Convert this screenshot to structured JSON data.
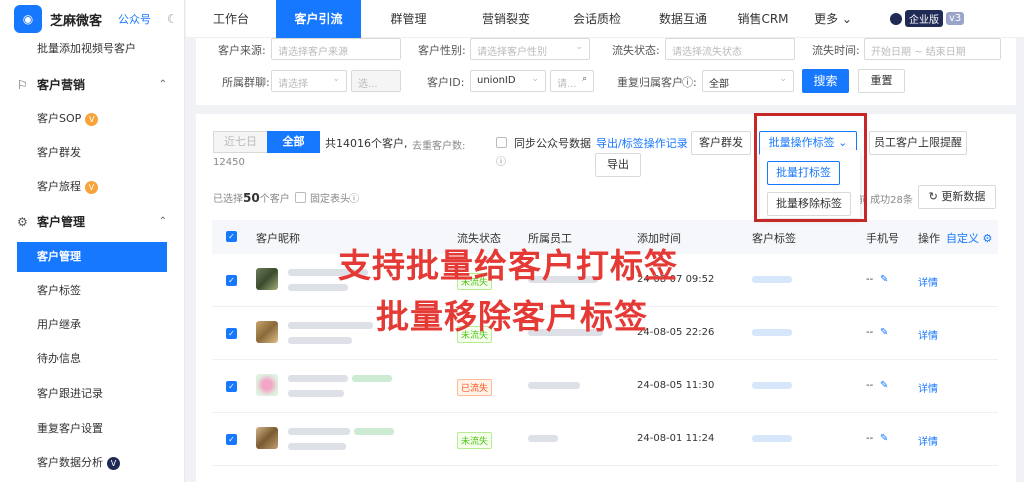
{
  "sidebar": {
    "logo_glyph": "◉",
    "app_name": "芝麻微客",
    "account_type": "公众号",
    "items": [
      {
        "label": "批量添加视频号客户"
      },
      {
        "label": "客户营销",
        "group": true
      },
      {
        "label": "客户SOP"
      },
      {
        "label": "客户群发"
      },
      {
        "label": "客户旅程"
      },
      {
        "label": "客户管理",
        "group": true
      },
      {
        "label": "客户管理",
        "active": true
      },
      {
        "label": "客户标签"
      },
      {
        "label": "用户继承"
      },
      {
        "label": "待办信息"
      },
      {
        "label": "客户跟进记录"
      },
      {
        "label": "重复客户设置"
      },
      {
        "label": "客户数据分析"
      }
    ]
  },
  "topnav": {
    "items": [
      "工作台",
      "客户引流",
      "群管理",
      "营销裂变",
      "会话质检",
      "数据互通",
      "销售CRM",
      "更多 ⌄"
    ],
    "active": "客户引流",
    "edition": {
      "label": "企业版",
      "version": "v3"
    }
  },
  "filters": {
    "source_label": "客户来源:",
    "source_placeholder": "请选择客户来源",
    "gender_label": "客户性别:",
    "gender_placeholder": "请选择客户性别",
    "churn_label": "流失状态:",
    "churn_placeholder": "请选择流失状态",
    "churn_time_label": "流失时间:",
    "start_date": "开始日期",
    "date_sep": "~",
    "end_date": "结束日期",
    "group_label": "所属群聊:",
    "group_placeholder": "请选择",
    "group_placeholder2": "选...",
    "customer_id_label": "客户ID:",
    "id_type": "unionID",
    "id_placeholder": "请...",
    "repeat_label": "重复归属客户",
    "repeat_value": "全部",
    "search_button": "搜索",
    "reset_button": "重置"
  },
  "main": {
    "seg_7days": "近七日",
    "seg_all": "全部",
    "total_text": "共14016个客户,",
    "dedupe_label": "去重客户数:",
    "dedupe_value": "12450",
    "sync_label": "同步公众号数据",
    "export_link": "导出/标签操作记录",
    "group_send_button": "客户群发",
    "batch_tag_button": "批量操作标签",
    "limit_reminder_button": "员工客户上限提醒",
    "export_button": "导出",
    "dropdown": {
      "add_tag": "批量打标签",
      "remove_tag": "批量移除标签"
    },
    "selected_prefix": "已选择",
    "selected_count": "50",
    "selected_suffix": "个客户",
    "fixed_header_label": "固定表头",
    "success_text": "前 成功28条",
    "refresh_button": "更新数据"
  },
  "table": {
    "headers": [
      "客户昵称",
      "流失状态",
      "所属员工",
      "添加时间",
      "客户标签",
      "手机号",
      "操作",
      "自定义"
    ],
    "rows": [
      {
        "status": "未流失",
        "status_type": "green",
        "time": "24-08-07 09:52",
        "phone": "--",
        "action": "详情"
      },
      {
        "status": "未流失",
        "status_type": "green",
        "time": "24-08-05 22:26",
        "phone": "--",
        "action": "详情"
      },
      {
        "status": "已流失",
        "status_type": "orange",
        "time": "24-08-05 11:30",
        "phone": "--",
        "action": "详情"
      },
      {
        "status": "未流失",
        "status_type": "green",
        "time": "24-08-01 11:24",
        "phone": "--",
        "action": "详情"
      }
    ]
  },
  "overlay": {
    "line1": "支持批量给客户打标签",
    "line2": "批量移除客户标签"
  },
  "colors": {
    "primary": "#1677ff",
    "highlight_box": "#c62828",
    "overlay_text": "#e53935"
  }
}
